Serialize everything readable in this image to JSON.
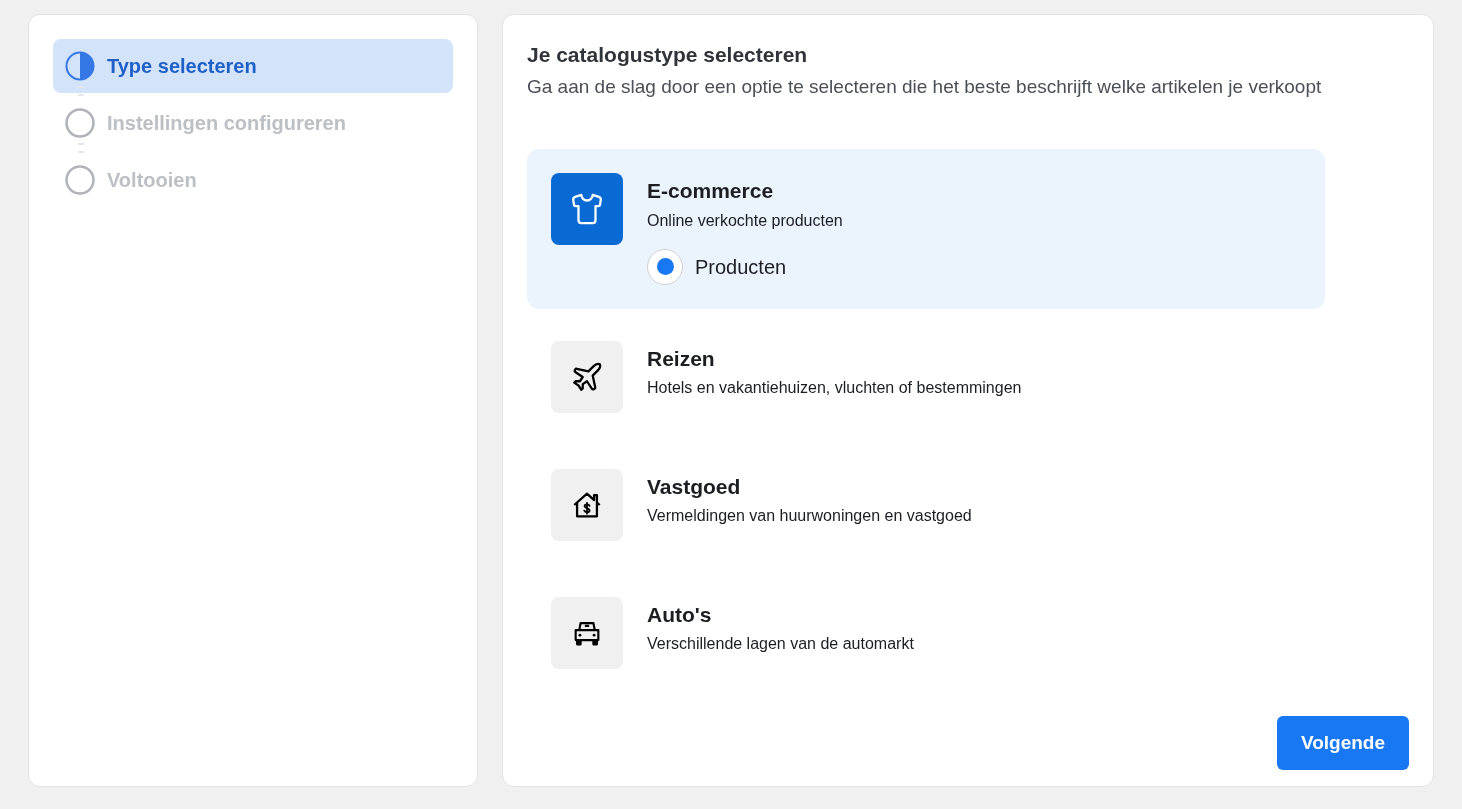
{
  "steps": [
    {
      "label": "Type selecteren",
      "kind": "current",
      "selected": true
    },
    {
      "label": "Instellingen configureren",
      "kind": "pending",
      "selected": false
    },
    {
      "label": "Voltooien",
      "kind": "pending",
      "selected": false
    }
  ],
  "panel": {
    "title": "Je catalogustype selecteren",
    "subtitle": "Ga aan de slag door een optie te selecteren die het beste beschrijft welke artikelen je verkoopt"
  },
  "catalog_types": [
    {
      "kind": "shirt",
      "title": "E-commerce",
      "description": "Online verkochte producten",
      "selected": true,
      "options": [
        {
          "label": "Producten",
          "selected": true
        }
      ]
    },
    {
      "kind": "plane",
      "title": "Reizen",
      "description": "Hotels en vakantiehuizen, vluchten of bestemmingen",
      "selected": false
    },
    {
      "kind": "house",
      "title": "Vastgoed",
      "description": "Vermeldingen van huurwoningen en vastgoed",
      "selected": false
    },
    {
      "kind": "car",
      "title": "Auto's",
      "description": "Verschillende lagen van de automarkt",
      "selected": false
    }
  ],
  "next_button": "Volgende"
}
